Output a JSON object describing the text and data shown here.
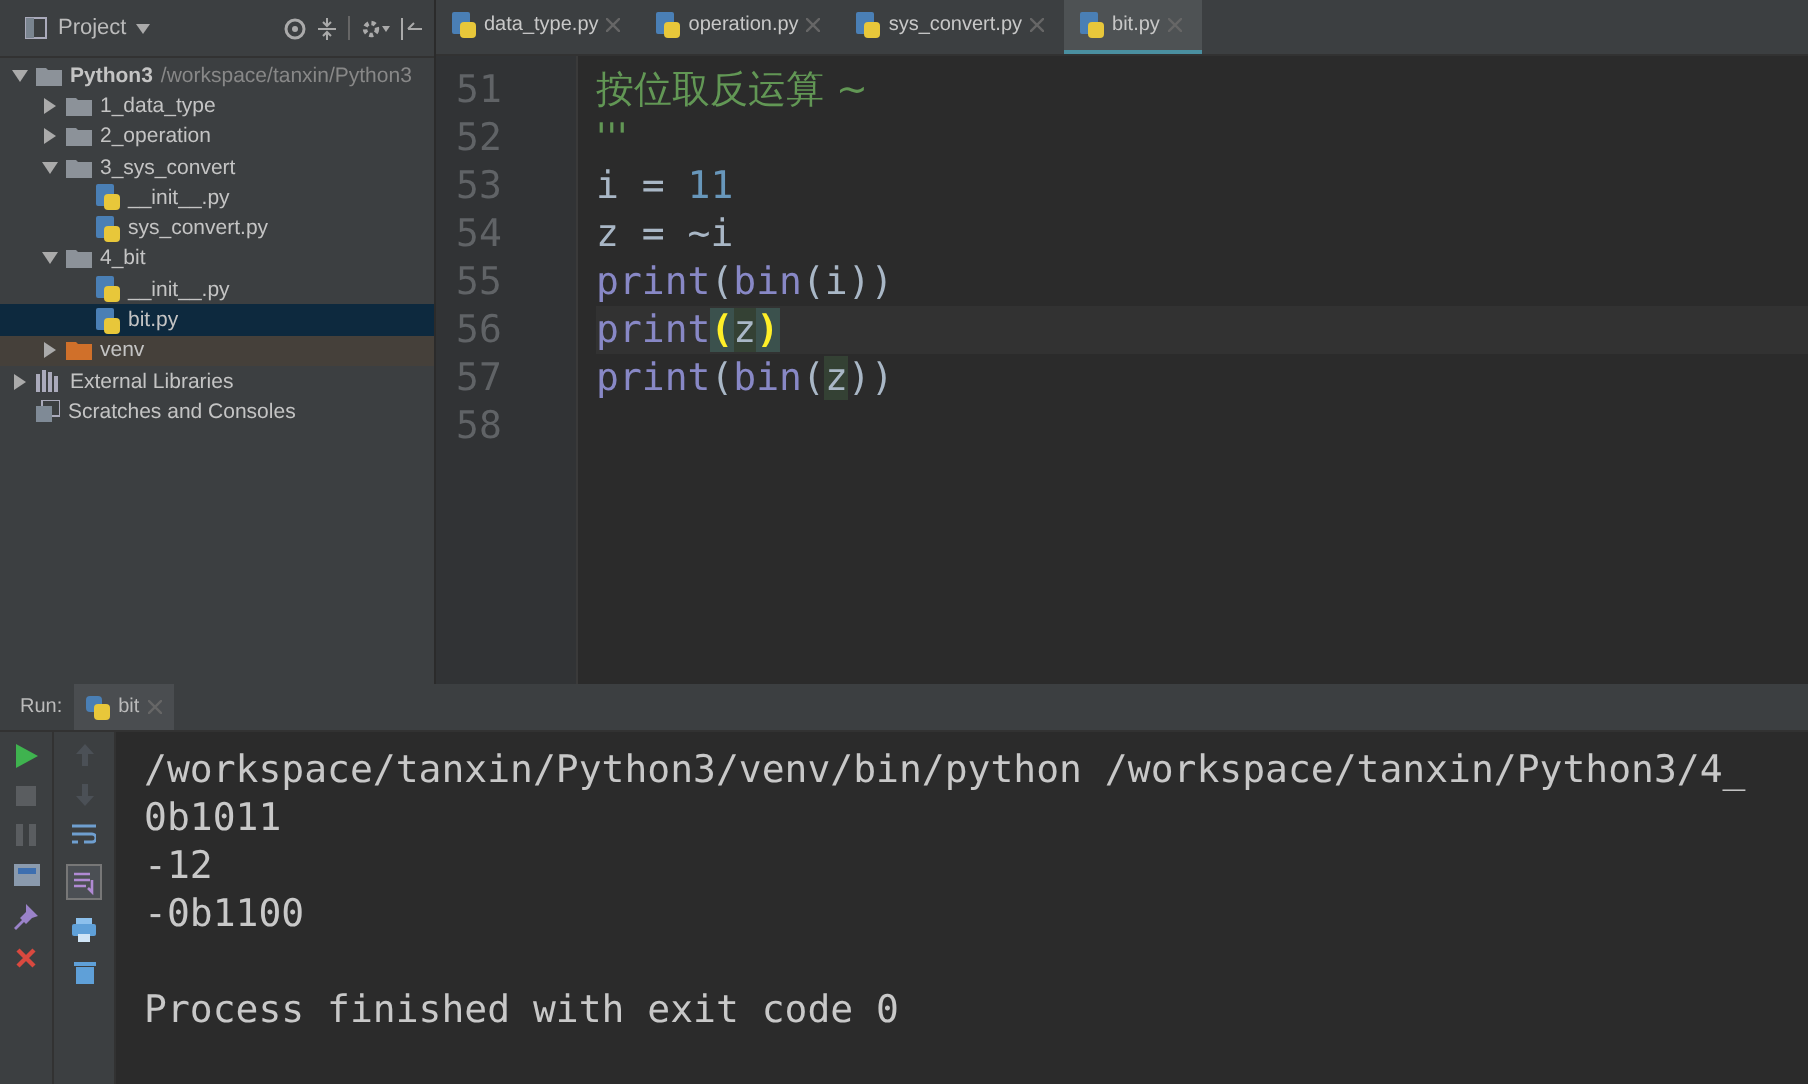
{
  "project_panel": {
    "title": "Project",
    "tree": [
      {
        "kind": "folder",
        "label": "Python3",
        "path": "/workspace/tanxin/Python3",
        "expanded": true,
        "selected": false,
        "children": [
          {
            "kind": "folder",
            "label": "1_data_type",
            "expanded": false,
            "selected": false
          },
          {
            "kind": "folder",
            "label": "2_operation",
            "expanded": false,
            "selected": false
          },
          {
            "kind": "folder",
            "label": "3_sys_convert",
            "expanded": true,
            "selected": false,
            "children": [
              {
                "kind": "pyfile",
                "label": "__init__.py",
                "selected": false
              },
              {
                "kind": "pyfile",
                "label": "sys_convert.py",
                "selected": false
              }
            ]
          },
          {
            "kind": "folder",
            "label": "4_bit",
            "expanded": true,
            "selected": false,
            "children": [
              {
                "kind": "pyfile",
                "label": "__init__.py",
                "selected": false
              },
              {
                "kind": "pyfile",
                "label": "bit.py",
                "selected": true
              }
            ]
          },
          {
            "kind": "folder",
            "label": "venv",
            "excluded": true,
            "expanded": false,
            "selected": false
          }
        ]
      },
      {
        "kind": "libraries",
        "label": "External Libraries",
        "expanded": false,
        "selected": false
      },
      {
        "kind": "scratches",
        "label": "Scratches and Consoles",
        "selected": false
      }
    ]
  },
  "editor": {
    "tabs": [
      {
        "label": "data_type.py",
        "selected": false
      },
      {
        "label": "operation.py",
        "selected": false
      },
      {
        "label": "sys_convert.py",
        "selected": false
      },
      {
        "label": "bit.py",
        "selected": true
      }
    ],
    "lines": [
      {
        "number": "51",
        "tokens": [
          {
            "kind": "comment",
            "text": "按位取反运算 ~"
          }
        ]
      },
      {
        "number": "52",
        "tokens": [
          {
            "kind": "comment",
            "text": "'''"
          }
        ]
      },
      {
        "number": "53",
        "tokens": [
          {
            "kind": "plain",
            "text": "i = "
          },
          {
            "kind": "number",
            "text": "11"
          }
        ]
      },
      {
        "number": "54",
        "tokens": [
          {
            "kind": "plain",
            "text": "z = ~i"
          }
        ]
      },
      {
        "number": "55",
        "tokens": [
          {
            "kind": "builtin",
            "text": "print"
          },
          {
            "kind": "plain",
            "text": "("
          },
          {
            "kind": "builtin",
            "text": "bin"
          },
          {
            "kind": "plain",
            "text": "(i))"
          }
        ]
      },
      {
        "number": "56",
        "tokens": [
          {
            "kind": "builtin",
            "text": "print"
          },
          {
            "kind": "match",
            "text": "("
          },
          {
            "kind": "highlight",
            "text": "z"
          },
          {
            "kind": "match",
            "text": ")"
          }
        ]
      },
      {
        "number": "57",
        "tokens": [
          {
            "kind": "builtin",
            "text": "print"
          },
          {
            "kind": "plain",
            "text": "("
          },
          {
            "kind": "builtin",
            "text": "bin"
          },
          {
            "kind": "plain",
            "text": "("
          },
          {
            "kind": "highlight",
            "text": "z"
          },
          {
            "kind": "plain",
            "text": "))"
          }
        ]
      },
      {
        "number": "58"
      }
    ]
  },
  "run_panel": {
    "label": "Run:",
    "tab": "bit",
    "output": [
      "/workspace/tanxin/Python3/venv/bin/python /workspace/tanxin/Python3/4_",
      "0b1011",
      "-12",
      "-0b1100"
    ],
    "exit_message": "Process finished with exit code 0"
  }
}
